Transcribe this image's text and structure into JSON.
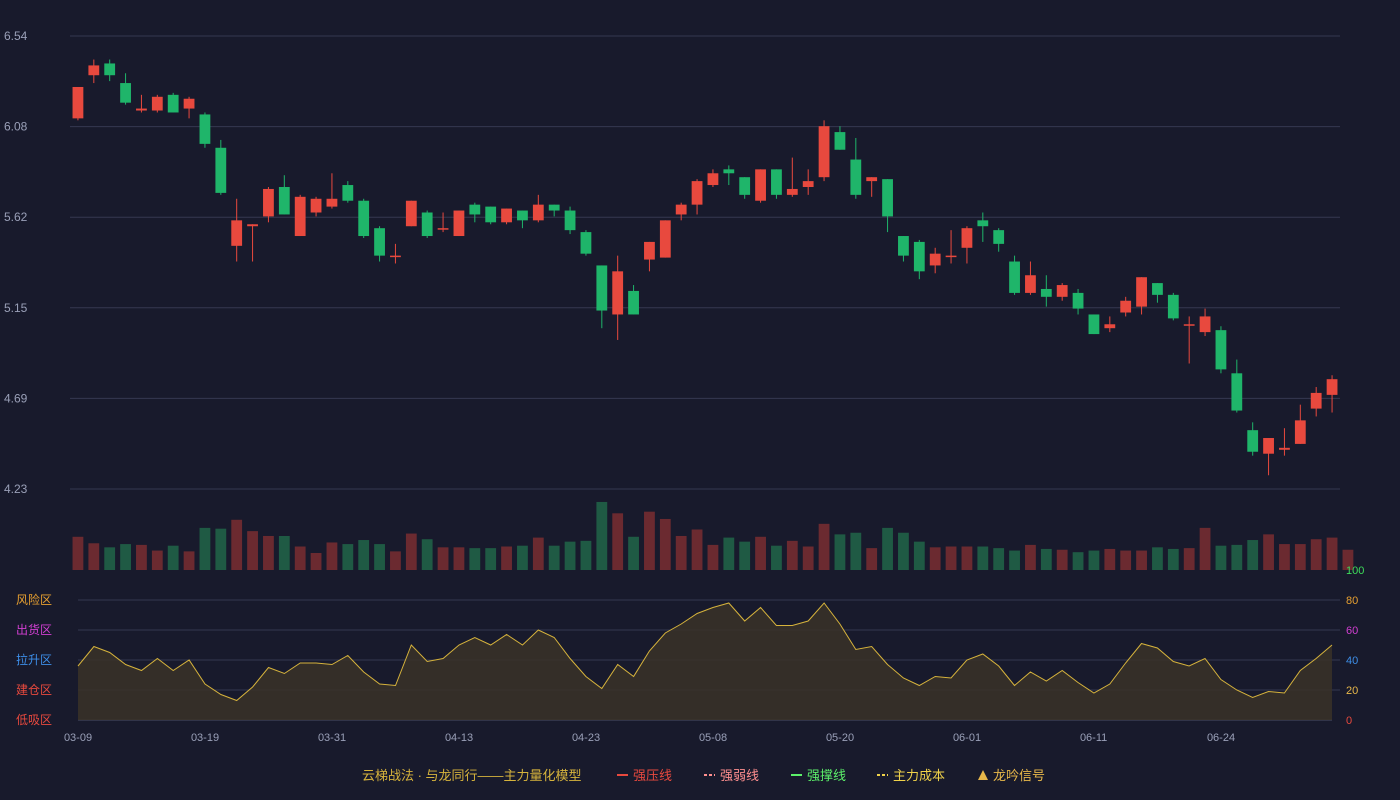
{
  "colors": {
    "background": "#181a2c",
    "up": "#e8493e",
    "down": "#1fb56a",
    "volume_up": "#6b2a30",
    "volume_down": "#1f5a44",
    "grid": "#353850",
    "tick": "#9aa0b8",
    "indicator_line": "#d6b33c",
    "indicator_fill": "#3a3328"
  },
  "chart_data": [
    {
      "type": "candlestick",
      "title": "",
      "y_ticks": [
        "6.54",
        "6.08",
        "5.62",
        "5.15",
        "4.69",
        "4.23"
      ],
      "ylim": [
        4.23,
        6.54
      ],
      "grid": true,
      "x_tick_labels": [
        "03-09",
        "03-19",
        "03-31",
        "04-13",
        "04-23",
        "05-08",
        "05-20",
        "06-01",
        "06-11",
        "06-24"
      ],
      "x_tick_indices": [
        0,
        8,
        16,
        24,
        32,
        40,
        48,
        56,
        64,
        72
      ],
      "ohlc": [
        [
          6.12,
          6.28,
          6.11,
          6.27
        ],
        [
          6.34,
          6.39,
          6.3,
          6.42
        ],
        [
          6.4,
          6.34,
          6.31,
          6.42
        ],
        [
          6.3,
          6.2,
          6.19,
          6.35
        ],
        [
          6.16,
          6.17,
          6.15,
          6.24
        ],
        [
          6.16,
          6.23,
          6.15,
          6.24
        ],
        [
          6.24,
          6.15,
          6.15,
          6.25
        ],
        [
          6.17,
          6.22,
          6.12,
          6.23
        ],
        [
          6.14,
          5.99,
          5.97,
          6.15
        ],
        [
          5.97,
          5.74,
          5.73,
          6.01
        ],
        [
          5.47,
          5.6,
          5.39,
          5.71
        ],
        [
          5.57,
          5.58,
          5.39,
          5.58
        ],
        [
          5.62,
          5.76,
          5.59,
          5.77
        ],
        [
          5.77,
          5.63,
          5.63,
          5.83
        ],
        [
          5.52,
          5.72,
          5.52,
          5.73
        ],
        [
          5.64,
          5.71,
          5.62,
          5.72
        ],
        [
          5.67,
          5.71,
          5.66,
          5.84
        ],
        [
          5.78,
          5.7,
          5.69,
          5.8
        ],
        [
          5.7,
          5.52,
          5.51,
          5.71
        ],
        [
          5.56,
          5.42,
          5.39,
          5.57
        ],
        [
          5.42,
          5.42,
          5.38,
          5.48
        ],
        [
          5.57,
          5.7,
          5.57,
          5.7
        ],
        [
          5.64,
          5.52,
          5.51,
          5.65
        ],
        [
          5.56,
          5.56,
          5.54,
          5.64
        ],
        [
          5.52,
          5.65,
          5.52,
          5.65
        ],
        [
          5.68,
          5.63,
          5.59,
          5.69
        ],
        [
          5.67,
          5.59,
          5.58,
          5.67
        ],
        [
          5.59,
          5.66,
          5.58,
          5.66
        ],
        [
          5.65,
          5.6,
          5.56,
          5.65
        ],
        [
          5.6,
          5.68,
          5.59,
          5.73
        ],
        [
          5.68,
          5.65,
          5.62,
          5.68
        ],
        [
          5.65,
          5.55,
          5.53,
          5.67
        ],
        [
          5.54,
          5.43,
          5.42,
          5.55
        ],
        [
          5.37,
          5.14,
          5.05,
          5.37
        ],
        [
          5.12,
          5.34,
          4.99,
          5.42
        ],
        [
          5.24,
          5.12,
          5.12,
          5.27
        ],
        [
          5.4,
          5.49,
          5.34,
          5.49
        ],
        [
          5.41,
          5.6,
          5.41,
          5.6
        ],
        [
          5.63,
          5.68,
          5.6,
          5.69
        ],
        [
          5.68,
          5.8,
          5.63,
          5.81
        ],
        [
          5.78,
          5.84,
          5.77,
          5.86
        ],
        [
          5.86,
          5.84,
          5.78,
          5.88
        ],
        [
          5.82,
          5.73,
          5.71,
          5.82
        ],
        [
          5.7,
          5.86,
          5.69,
          5.86
        ],
        [
          5.86,
          5.73,
          5.71,
          5.86
        ],
        [
          5.73,
          5.76,
          5.72,
          5.92
        ],
        [
          5.77,
          5.8,
          5.73,
          5.86
        ],
        [
          5.82,
          6.08,
          5.8,
          6.11
        ],
        [
          6.05,
          5.96,
          5.96,
          6.08
        ],
        [
          5.91,
          5.73,
          5.71,
          6.02
        ],
        [
          5.8,
          5.82,
          5.72,
          5.82
        ],
        [
          5.81,
          5.62,
          5.54,
          5.81
        ],
        [
          5.52,
          5.42,
          5.39,
          5.52
        ],
        [
          5.49,
          5.34,
          5.3,
          5.5
        ],
        [
          5.37,
          5.43,
          5.33,
          5.46
        ],
        [
          5.42,
          5.42,
          5.38,
          5.55
        ],
        [
          5.46,
          5.56,
          5.38,
          5.57
        ],
        [
          5.6,
          5.57,
          5.49,
          5.64
        ],
        [
          5.55,
          5.48,
          5.44,
          5.56
        ],
        [
          5.39,
          5.23,
          5.22,
          5.42
        ],
        [
          5.23,
          5.32,
          5.22,
          5.39
        ],
        [
          5.25,
          5.21,
          5.16,
          5.32
        ],
        [
          5.21,
          5.27,
          5.19,
          5.28
        ],
        [
          5.23,
          5.15,
          5.12,
          5.25
        ],
        [
          5.12,
          5.02,
          5.02,
          5.12
        ],
        [
          5.05,
          5.07,
          5.03,
          5.11
        ],
        [
          5.13,
          5.19,
          5.11,
          5.21
        ],
        [
          5.16,
          5.31,
          5.12,
          5.31
        ],
        [
          5.28,
          5.22,
          5.18,
          5.28
        ],
        [
          5.22,
          5.1,
          5.09,
          5.23
        ],
        [
          5.07,
          5.07,
          4.87,
          5.11
        ],
        [
          5.03,
          5.11,
          5.01,
          5.15
        ],
        [
          5.04,
          4.84,
          4.82,
          5.06
        ],
        [
          4.82,
          4.63,
          4.62,
          4.89
        ],
        [
          4.53,
          4.42,
          4.4,
          4.57
        ],
        [
          4.41,
          4.49,
          4.3,
          4.49
        ],
        [
          4.43,
          4.44,
          4.4,
          4.54
        ],
        [
          4.46,
          4.58,
          4.46,
          4.66
        ],
        [
          4.64,
          4.72,
          4.6,
          4.75
        ],
        [
          4.71,
          4.79,
          4.62,
          4.81
        ]
      ]
    },
    {
      "type": "bar",
      "title": "",
      "values": [
        41,
        33,
        28,
        32,
        31,
        24,
        30,
        23,
        52,
        51,
        62,
        48,
        42,
        42,
        29,
        21,
        34,
        32,
        37,
        32,
        23,
        45,
        38,
        28,
        28,
        27,
        27,
        29,
        30,
        40,
        30,
        35,
        36,
        84,
        70,
        41,
        72,
        63,
        42,
        50,
        31,
        40,
        35,
        41,
        30,
        36,
        29,
        57,
        44,
        46,
        27,
        52,
        46,
        35,
        28,
        29,
        29,
        29,
        27,
        24,
        31,
        26,
        25,
        22,
        24,
        26,
        24,
        24,
        28,
        26,
        27,
        52,
        30,
        31,
        37,
        44,
        32,
        32,
        38,
        40,
        25
      ],
      "ylim": [
        0,
        100
      ]
    },
    {
      "type": "area",
      "title": "",
      "y_ticks": [
        "0",
        "20",
        "40",
        "60",
        "80",
        "100"
      ],
      "ylim": [
        0,
        100
      ],
      "zones": [
        "风险区",
        "出货区",
        "拉升区",
        "建仓区",
        "低吸区"
      ],
      "values": [
        36,
        49,
        45,
        37,
        33,
        41,
        33,
        40,
        24,
        17,
        13,
        22,
        35,
        31,
        38,
        38,
        37,
        43,
        32,
        24,
        23,
        50,
        39,
        41,
        50,
        55,
        50,
        57,
        50,
        60,
        55,
        41,
        29,
        21,
        37,
        29,
        46,
        58,
        64,
        71,
        75,
        78,
        66,
        75,
        63,
        63,
        66,
        78,
        64,
        47,
        49,
        37,
        28,
        23,
        29,
        28,
        40,
        44,
        36,
        23,
        32,
        26,
        33,
        25,
        18,
        24,
        38,
        51,
        48,
        39,
        36,
        41,
        27,
        20,
        15,
        19,
        18,
        33,
        41,
        50
      ]
    }
  ],
  "legend": [
    {
      "label": "云梯战法 · 与龙同行——主力量化模型",
      "color": "#d6b33c",
      "marker": "none"
    },
    {
      "label": "强压线",
      "color": "#e8493e",
      "marker": "solid"
    },
    {
      "label": "强弱线",
      "color": "#ff8f8f",
      "marker": "dashed"
    },
    {
      "label": "强撑线",
      "color": "#5cf06a",
      "marker": "solid"
    },
    {
      "label": "主力成本",
      "color": "#f0d24a",
      "marker": "dashed"
    },
    {
      "label": "龙吟信号",
      "color": "#e8b84a",
      "marker": "triangle"
    }
  ]
}
